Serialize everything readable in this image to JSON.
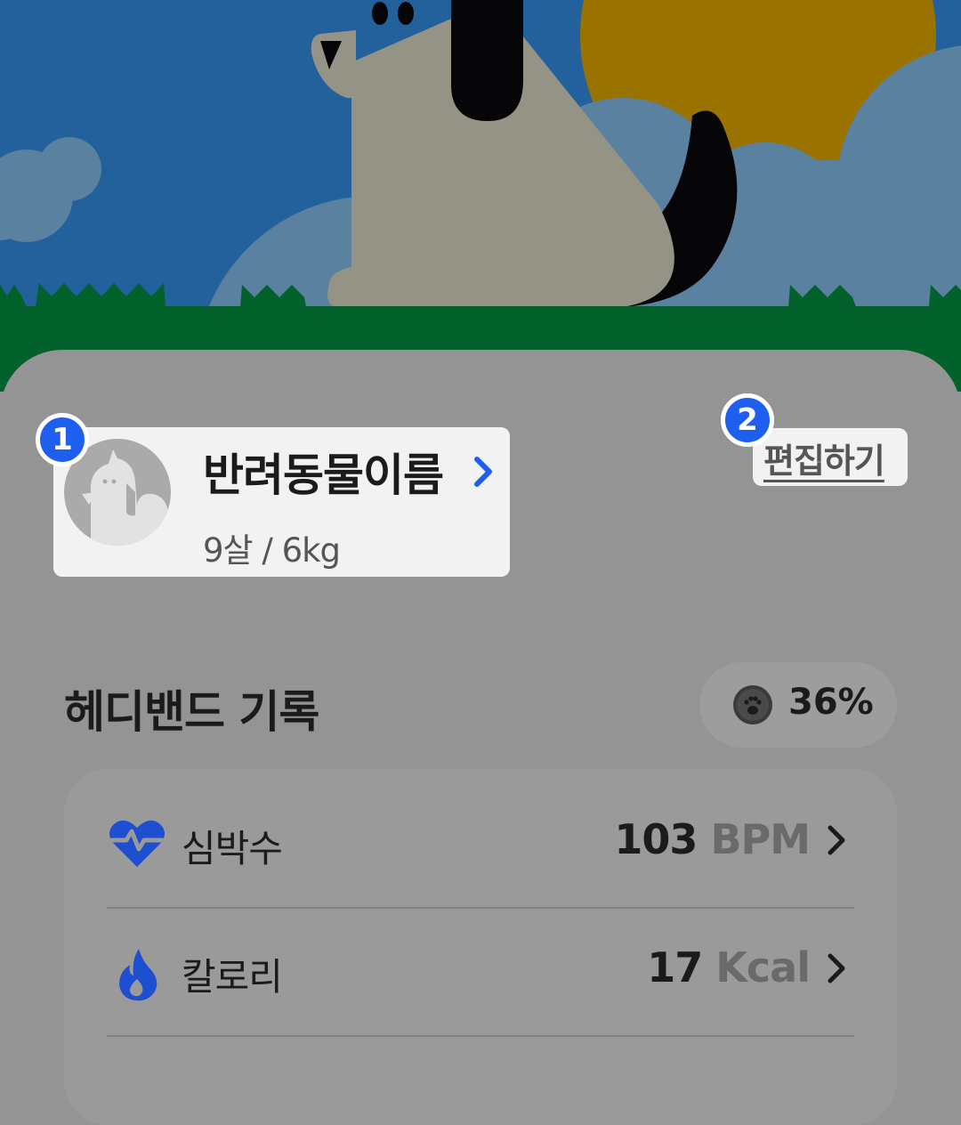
{
  "profile": {
    "name": "반려동물이름",
    "info": "9살 / 6kg",
    "edit_label": "편집하기"
  },
  "badges": {
    "first": "1",
    "second": "2"
  },
  "headband": {
    "title": "헤디밴드 기록",
    "battery": "36%"
  },
  "records": [
    {
      "label": "심박수",
      "value": "103",
      "unit": "BPM",
      "icon": "heart-pulse-icon"
    },
    {
      "label": "칼로리",
      "value": "17",
      "unit": "Kcal",
      "icon": "flame-icon"
    }
  ],
  "colors": {
    "accent_blue": "#1f5ff0",
    "sky": "#22619b",
    "grass": "#03612b",
    "sun": "#9a7200",
    "overlay_gray": "#949494"
  }
}
